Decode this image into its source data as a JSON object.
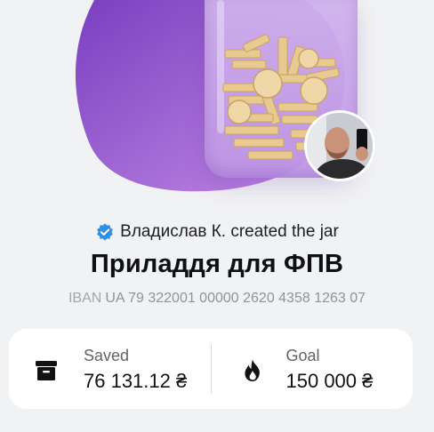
{
  "creator": {
    "name_text": "Владислав К. created the jar",
    "verified_icon": "verified-check-icon",
    "verified_color": "#2f8fe0"
  },
  "jar": {
    "title": "Приладдя для ФПВ",
    "iban_label": "IBAN",
    "iban_value": "UA 79 322001 00000 2620 4358 1263 07"
  },
  "stats": {
    "saved": {
      "label": "Saved",
      "value": "76 131.12 ₴",
      "icon": "archive-box-icon"
    },
    "goal": {
      "label": "Goal",
      "value": "150 000 ₴",
      "icon": "flame-icon"
    }
  },
  "colors": {
    "accent_purple": "#9b5fd6",
    "background": "#f1f2f4"
  }
}
